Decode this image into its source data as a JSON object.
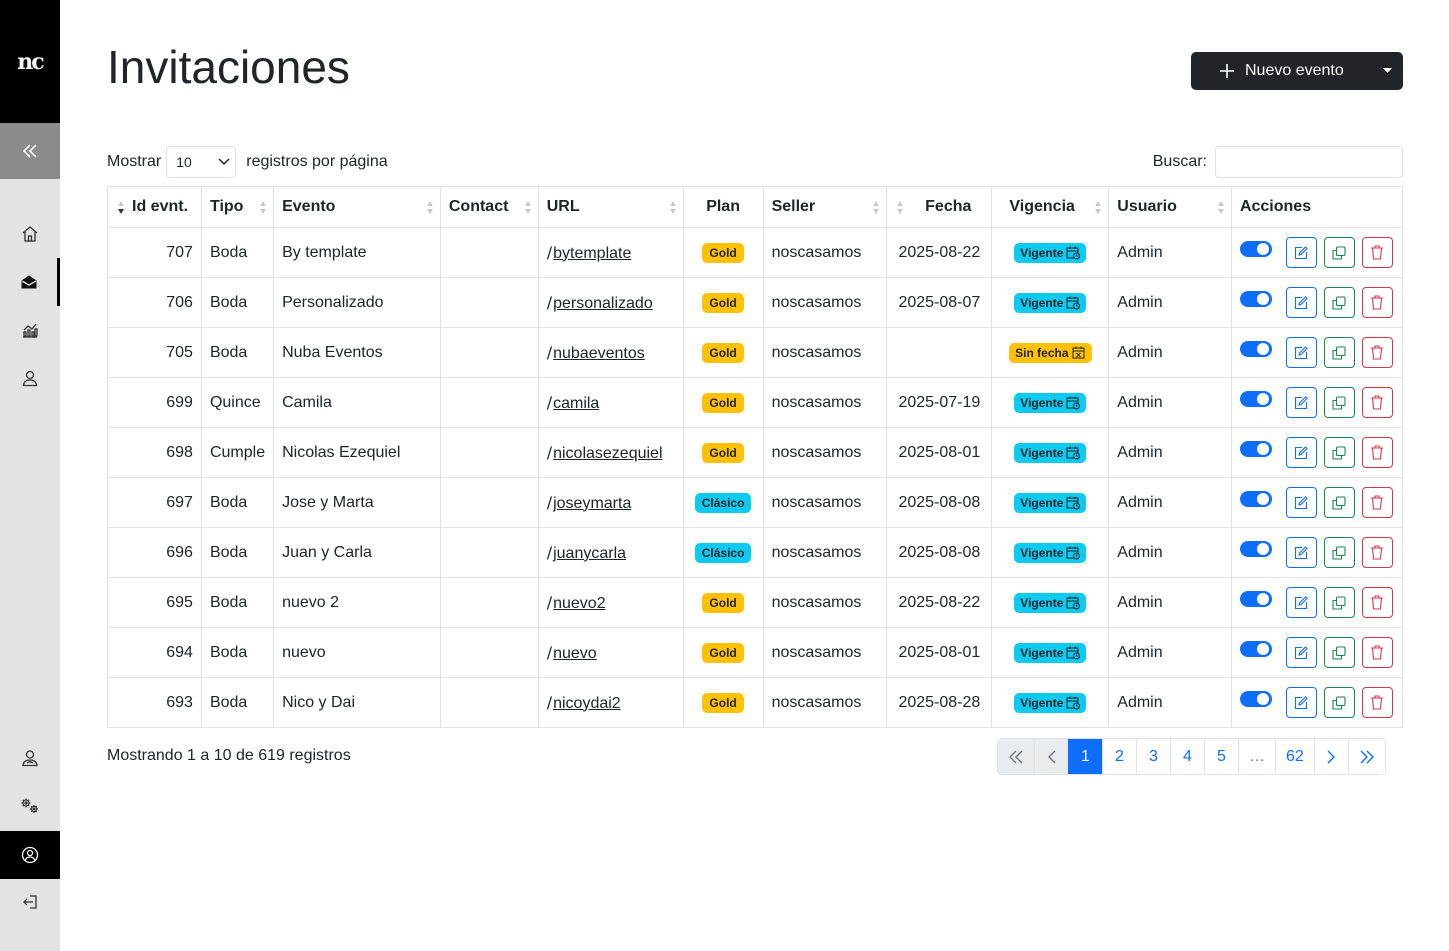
{
  "sidebar": {
    "logo_text": "nc",
    "items": [
      {
        "name": "home-icon"
      },
      {
        "name": "envelope-open-icon"
      },
      {
        "name": "chart-icon"
      },
      {
        "name": "user-icon"
      }
    ],
    "bottom_items": [
      {
        "name": "user-admin-icon"
      },
      {
        "name": "gears-icon"
      },
      {
        "name": "user-circle-icon"
      },
      {
        "name": "logout-icon"
      }
    ]
  },
  "header": {
    "title": "Invitaciones",
    "new_event_label": "Nuevo evento"
  },
  "length": {
    "prefix": "Mostrar",
    "value": "10",
    "suffix": "registros por página"
  },
  "search": {
    "label": "Buscar:",
    "value": ""
  },
  "table": {
    "columns": [
      "Id evnt.",
      "Tipo",
      "Evento",
      "Contact",
      "URL",
      "Plan",
      "Seller",
      "Fecha",
      "Vigencia",
      "Usuario",
      "Acciones"
    ],
    "rows": [
      {
        "id": "707",
        "tipo": "Boda",
        "evento": "By template",
        "contact": "",
        "url": "bytemplate",
        "plan": "Gold",
        "seller": "noscasamos",
        "fecha": "2025-08-22",
        "vigencia": "Vigente",
        "usuario": "Admin"
      },
      {
        "id": "706",
        "tipo": "Boda",
        "evento": "Personalizado",
        "contact": "",
        "url": "personalizado",
        "plan": "Gold",
        "seller": "noscasamos",
        "fecha": "2025-08-07",
        "vigencia": "Vigente",
        "usuario": "Admin"
      },
      {
        "id": "705",
        "tipo": "Boda",
        "evento": "Nuba Eventos",
        "contact": "",
        "url": "nubaeventos",
        "plan": "Gold",
        "seller": "noscasamos",
        "fecha": "",
        "vigencia": "Sin fecha",
        "usuario": "Admin"
      },
      {
        "id": "699",
        "tipo": "Quince",
        "evento": "Camila",
        "contact": "",
        "url": "camila",
        "plan": "Gold",
        "seller": "noscasamos",
        "fecha": "2025-07-19",
        "vigencia": "Vigente",
        "usuario": "Admin"
      },
      {
        "id": "698",
        "tipo": "Cumple",
        "evento": "Nicolas Ezequiel",
        "contact": "",
        "url": "nicolasezequiel",
        "plan": "Gold",
        "seller": "noscasamos",
        "fecha": "2025-08-01",
        "vigencia": "Vigente",
        "usuario": "Admin"
      },
      {
        "id": "697",
        "tipo": "Boda",
        "evento": "Jose y Marta",
        "contact": "",
        "url": "joseymarta",
        "plan": "Clásico",
        "seller": "noscasamos",
        "fecha": "2025-08-08",
        "vigencia": "Vigente",
        "usuario": "Admin"
      },
      {
        "id": "696",
        "tipo": "Boda",
        "evento": "Juan y Carla",
        "contact": "",
        "url": "juanycarla",
        "plan": "Clásico",
        "seller": "noscasamos",
        "fecha": "2025-08-08",
        "vigencia": "Vigente",
        "usuario": "Admin"
      },
      {
        "id": "695",
        "tipo": "Boda",
        "evento": "nuevo 2",
        "contact": "",
        "url": "nuevo2",
        "plan": "Gold",
        "seller": "noscasamos",
        "fecha": "2025-08-22",
        "vigencia": "Vigente",
        "usuario": "Admin"
      },
      {
        "id": "694",
        "tipo": "Boda",
        "evento": "nuevo",
        "contact": "",
        "url": "nuevo",
        "plan": "Gold",
        "seller": "noscasamos",
        "fecha": "2025-08-01",
        "vigencia": "Vigente",
        "usuario": "Admin"
      },
      {
        "id": "693",
        "tipo": "Boda",
        "evento": "Nico y Dai",
        "contact": "",
        "url": "nicoydai2",
        "plan": "Gold",
        "seller": "noscasamos",
        "fecha": "2025-08-28",
        "vigencia": "Vigente",
        "usuario": "Admin"
      }
    ]
  },
  "info": "Mostrando 1 a 10 de 619 registros",
  "pagination": {
    "pages": [
      "1",
      "2",
      "3",
      "4",
      "5",
      "…",
      "62"
    ],
    "active": "1"
  },
  "colors": {
    "primary": "#0d6efd",
    "success": "#198754",
    "danger": "#dc3545",
    "gold": "#ffc107",
    "info": "#0dcaf0",
    "dark": "#212529"
  }
}
